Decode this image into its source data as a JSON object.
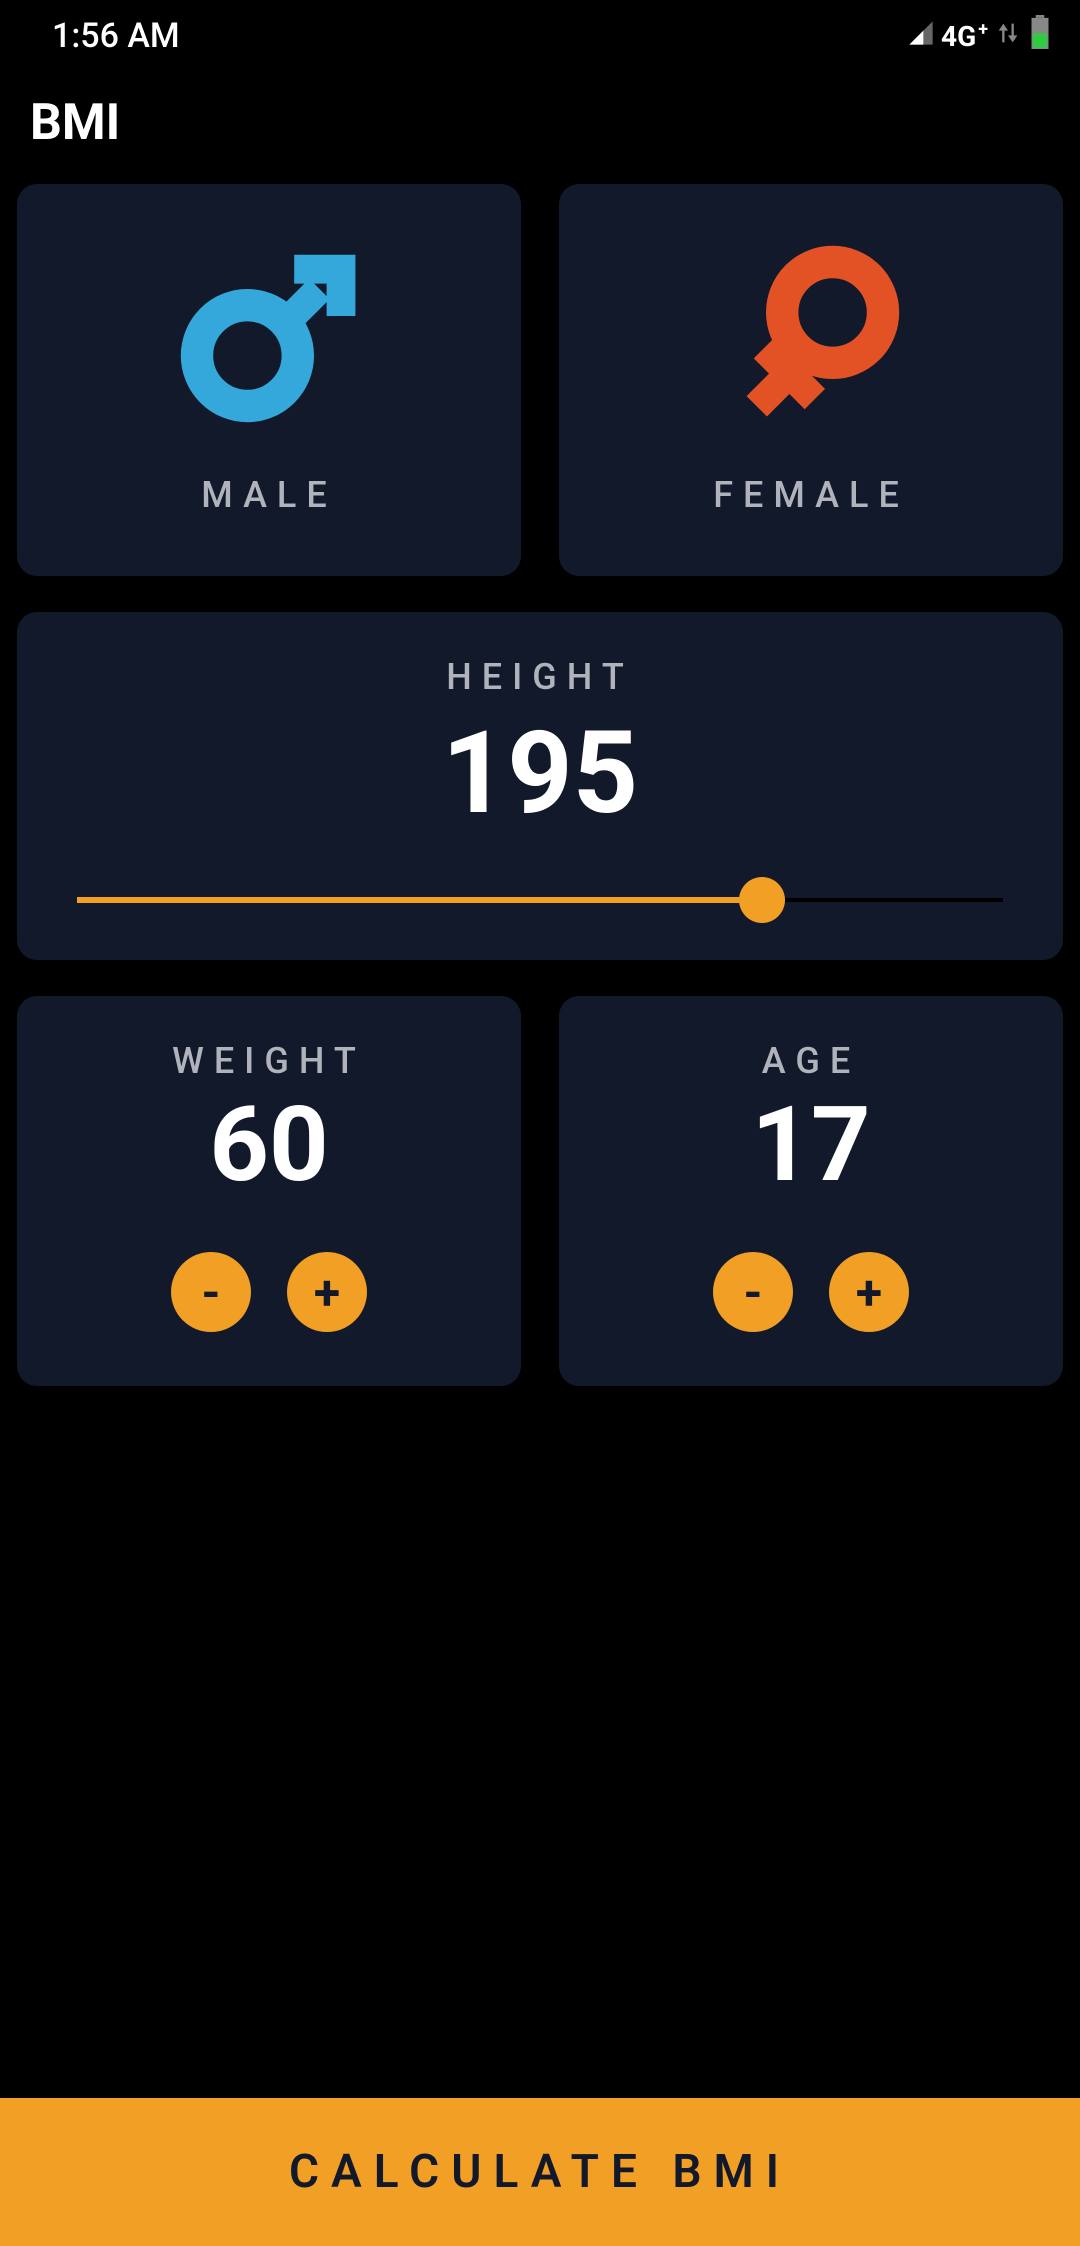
{
  "status": {
    "time": "1:56 AM",
    "network": "4G"
  },
  "title": "BMI",
  "gender": {
    "male": "MALE",
    "female": "FEMALE"
  },
  "height": {
    "label": "HEIGHT",
    "value": "195",
    "percent": 74
  },
  "weight": {
    "label": "WEIGHT",
    "value": "60"
  },
  "age": {
    "label": "AGE",
    "value": "17"
  },
  "buttons": {
    "minus": "-",
    "plus": "+"
  },
  "calculate": "CALCULATE BMI",
  "colors": {
    "accent": "#f29f25",
    "card": "#12192a",
    "male": "#34a8db",
    "female": "#e35225"
  }
}
